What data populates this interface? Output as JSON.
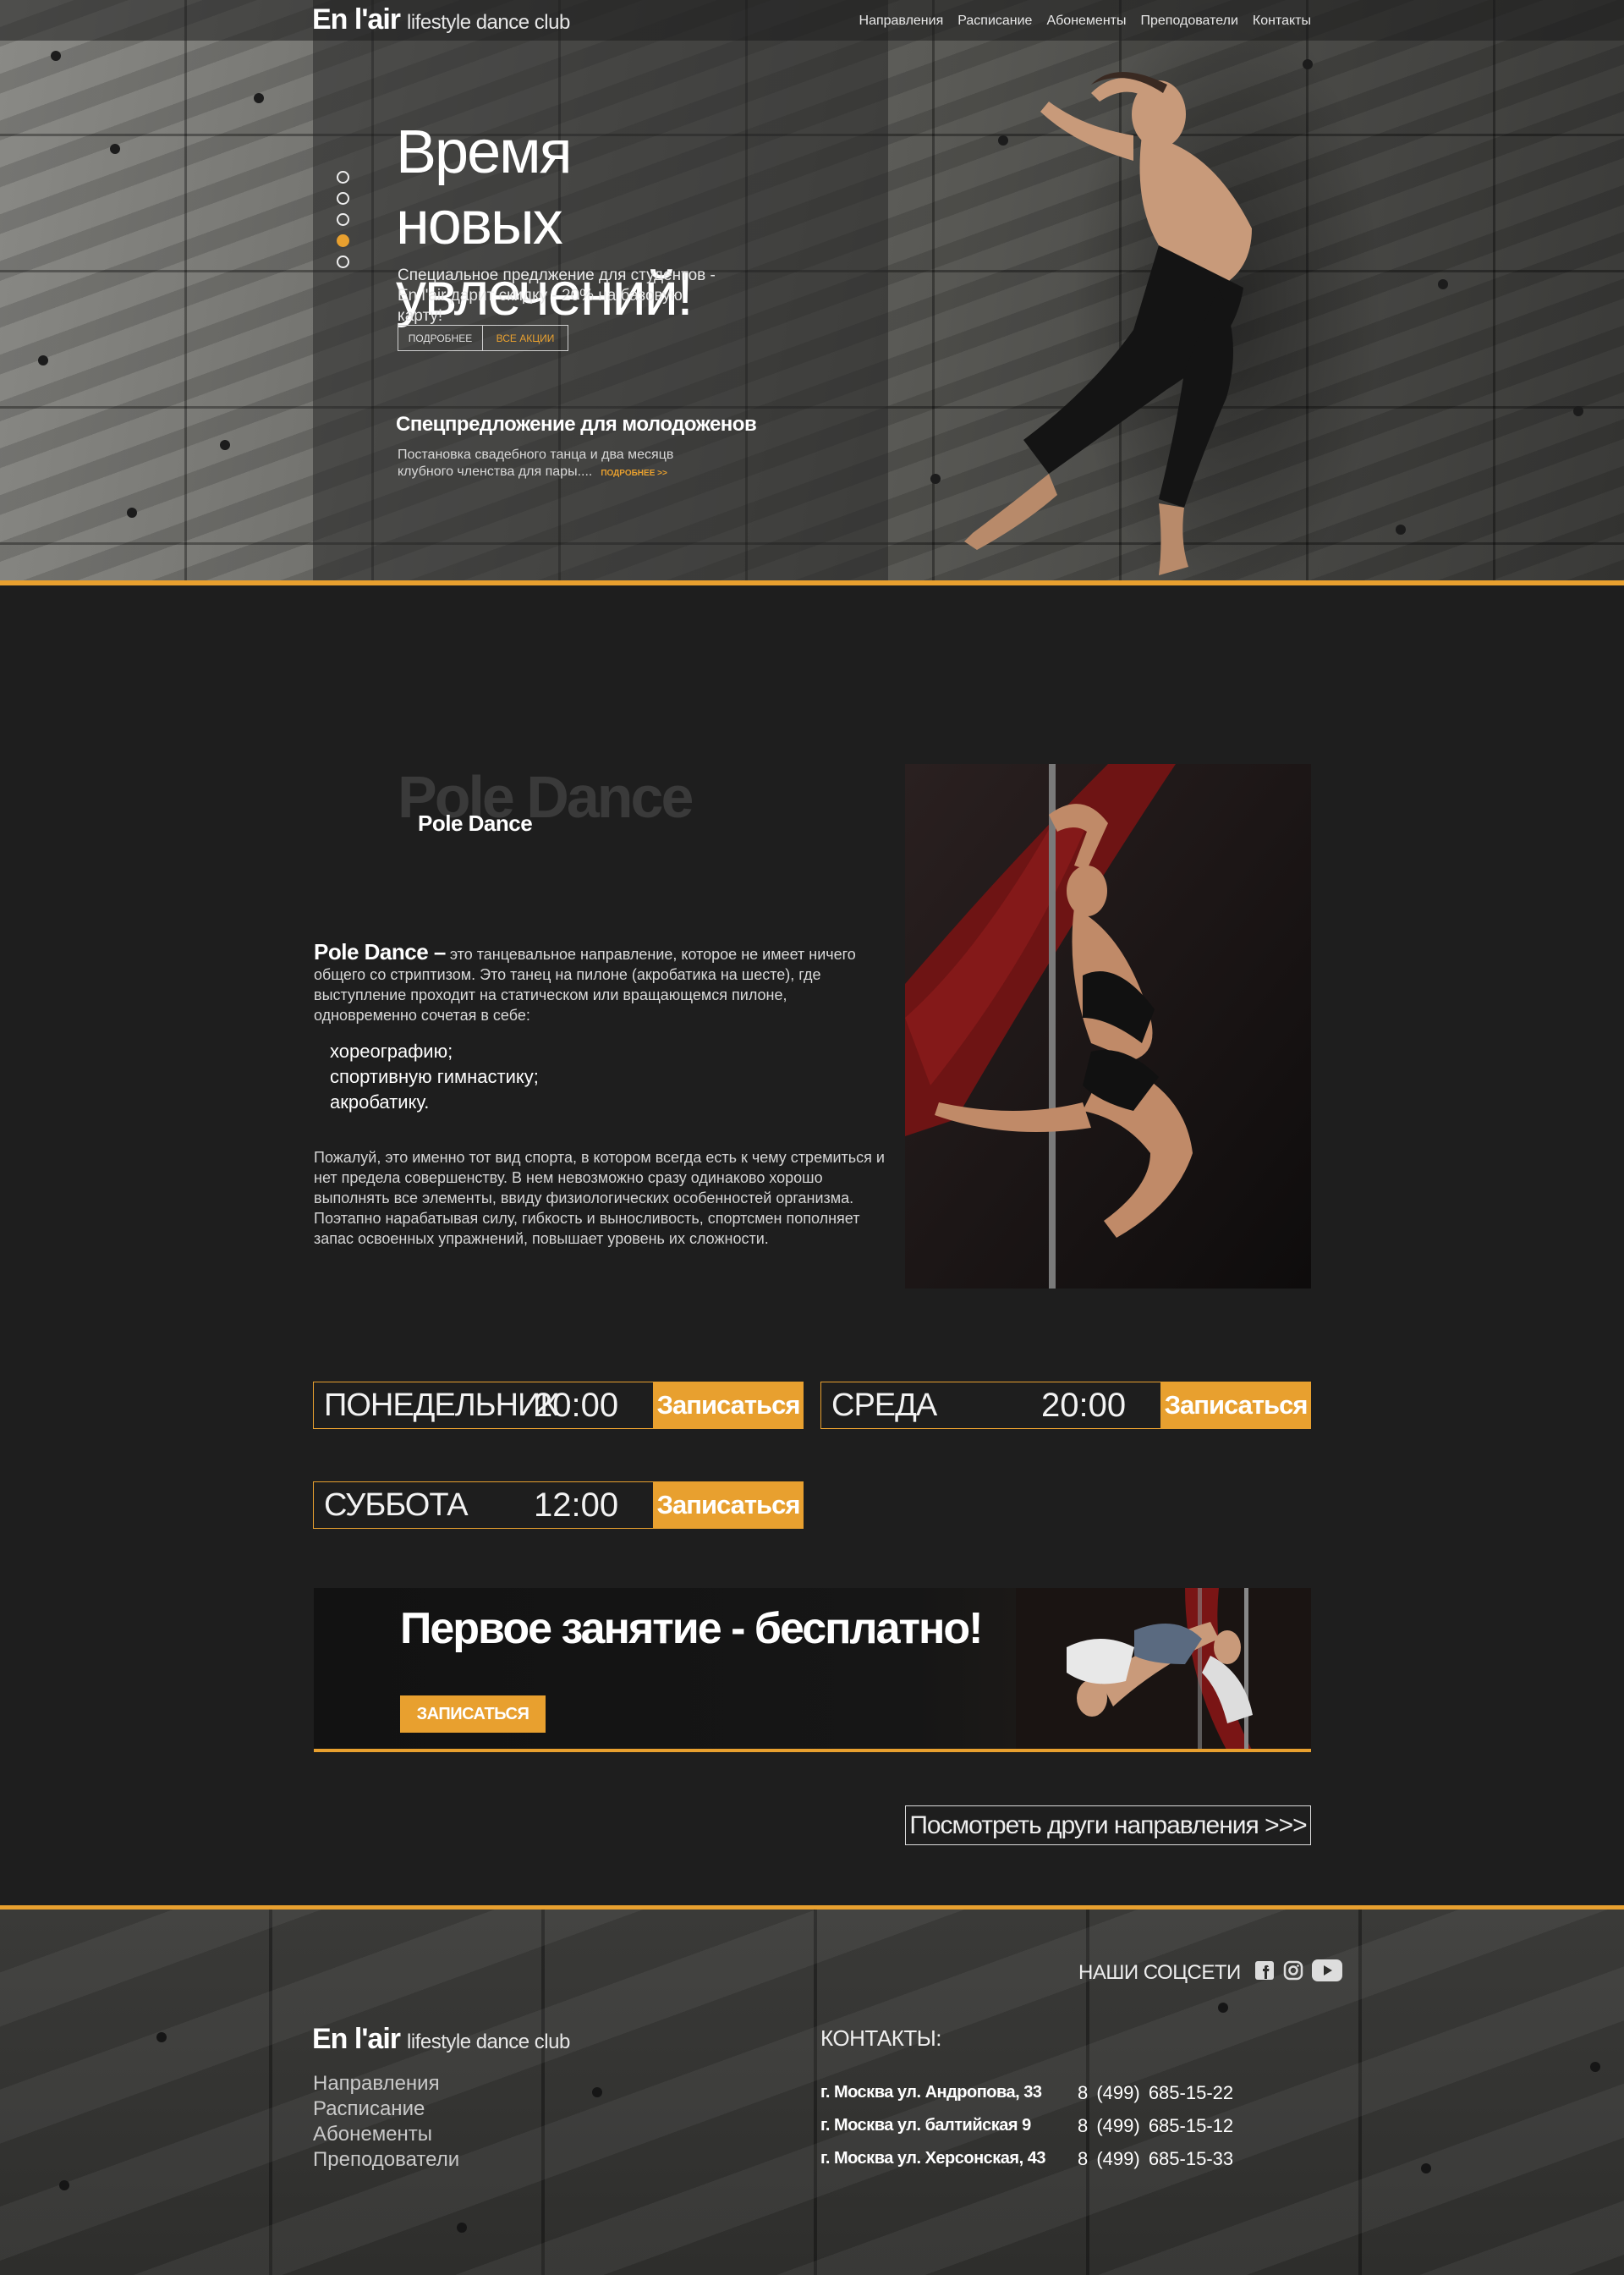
{
  "brand": {
    "name": "En l'air",
    "tagline": "lifestyle dance club"
  },
  "nav": [
    "Направления",
    "Расписание",
    "Абонементы",
    "Преподователи",
    "Контакты"
  ],
  "hero": {
    "title_line1": "Время новых",
    "title_line2": "увлечений!",
    "lead": "Специальное предлжение для студентов - En l'air дарит скидку - 20% на базовую карту!",
    "btn_more": "ПОДРОБНЕЕ",
    "btn_all": "ВСЕ АКЦИИ",
    "offer_title": "Спецпредложение для молодоженов",
    "offer_text": "Постановка свадебного танца и два месяцв клубного членства для пары....",
    "offer_link": "ПОДРОБНЕЕ >>",
    "slides": 5,
    "active_slide": 4
  },
  "section": {
    "ghost_title": "Pole Dance",
    "title": "Pole Dance",
    "intro_bold": "Pole Dance –",
    "intro": " это танцевальное направление, которое не имеет ничего общего со стриптизом. Это танец на пилоне (акробатика на шесте), где выступление проходит на статическом или вращающемся пилоне, одновременно сочетая в себе:",
    "list": [
      "хореографию;",
      "спортивную гимнастику;",
      "акробатику."
    ],
    "text2": "Пожалуй, это именно тот вид спорта, в котором всегда есть к чему стремиться и нет предела совершенству. В нем невозможно сразу одинаково хорошо выполнять все элементы, ввиду физиологических особенностей организма. Поэтапно нарабатывая силу, гибкость и выносливость, спортсмен пополняет запас освоенных упражнений, повышает уровень их сложности."
  },
  "schedule": [
    {
      "day": "ПОНЕДЕЛЬНИК",
      "time": "20:00",
      "action": "Записаться"
    },
    {
      "day": "СРЕДА",
      "time": "20:00",
      "action": "Записаться"
    },
    {
      "day": "СУББОТА",
      "time": "12:00",
      "action": "Записаться"
    }
  ],
  "banner": {
    "title": "Первое занятие - бесплатно!",
    "cta": "ЗАПИСАТЬСЯ"
  },
  "more_link": "Посмотреть други направления  >>>",
  "footer": {
    "social_label": "НАШИ СОЦСЕТИ",
    "social_icons": [
      "facebook-icon",
      "instagram-icon",
      "youtube-icon"
    ],
    "nav": [
      "Направления",
      "Расписание",
      "Абонементы",
      "Преподователи"
    ],
    "contacts_title": "КОНТАКТЫ:",
    "contacts": [
      {
        "address": "г. Москва ул. Андропова, 33",
        "phone": "8  (499)  685-15-22"
      },
      {
        "address": "г. Москва ул. балтийская 9",
        "phone": "8  (499)  685-15-12"
      },
      {
        "address": "г. Москва ул.  Херсонская, 43",
        "phone": "8  (499)  685-15-33"
      }
    ]
  },
  "colors": {
    "accent": "#e8a02f",
    "background": "#1e1e1e",
    "text": "#ffffff"
  }
}
